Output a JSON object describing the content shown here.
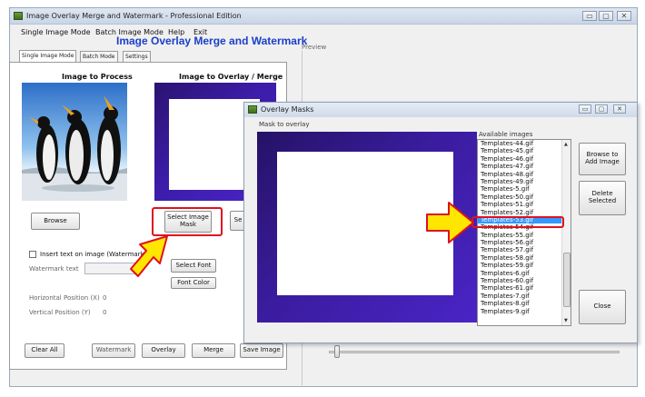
{
  "window": {
    "title": "Image Overlay Merge and Watermark - Professional Edition",
    "controls": [
      "▭",
      "▢",
      "✕"
    ]
  },
  "menu": [
    "Single Image Mode",
    "Batch Image Mode",
    "Help",
    "Exit"
  ],
  "app_title": "Image Overlay Merge and Watermark",
  "tabs": [
    "Single Image Mode",
    "Batch Mode",
    "Settings"
  ],
  "left_panel": {
    "image_to_process": "Image to Process",
    "image_to_overlay": "Image to Overlay / Merge",
    "browse_label": "Browse",
    "select_image_mask_label": "Select Image Mask",
    "partial_button_label": "Se",
    "insert_text_label": "Insert text on image (Watermark)",
    "watermark_text_label": "Watermark text",
    "select_font_label": "Select Font",
    "font_color_label": "Font Color",
    "horizontal_position_label": "Horizontal Position (X)",
    "horizontal_position_value": "0",
    "vertical_position_label": "Vertical Position (Y)",
    "vertical_position_value": "0",
    "clear_all_label": "Clear All",
    "watermark_label": "Watermark",
    "overlay_label": "Overlay",
    "merge_label": "Merge",
    "save_image_label": "Save Image"
  },
  "preview_label": "Preview",
  "dialog": {
    "title": "Overlay Masks",
    "controls": [
      "▭",
      "▢",
      "✕"
    ],
    "mask_to_overlay": "Mask to overlay",
    "available_images": "Available images",
    "items": [
      "Templates-44.gif",
      "Templates-45.gif",
      "Templates-46.gif",
      "Templates-47.gif",
      "Templates-48.gif",
      "Templates-49.gif",
      "Templates-5.gif",
      "Templates-50.gif",
      "Templates-51.gif",
      "Templates-52.gif",
      "Templates-53.gif",
      "Templates-54.gif",
      "Templates-55.gif",
      "Templates-56.gif",
      "Templates-57.gif",
      "Templates-58.gif",
      "Templates-59.gif",
      "Templates-6.gif",
      "Templates-60.gif",
      "Templates-61.gif",
      "Templates-7.gif",
      "Templates-8.gif",
      "Templates-9.gif"
    ],
    "selected_item": "Templates-53.gif",
    "browse_to_add_label": "Browse to Add Image",
    "delete_selected_label": "Delete Selected",
    "close_label": "Close"
  },
  "colors": {
    "accent_title": "#1a3fc8",
    "highlight_red": "#e01020",
    "arrow_yellow": "#ffe600",
    "selection_blue": "#3399ff",
    "mask_purple": "#3a1c9e"
  }
}
